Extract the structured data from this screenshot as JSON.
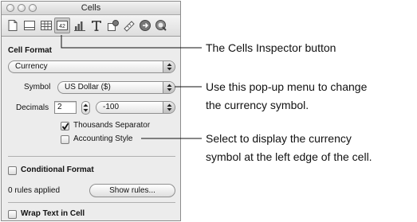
{
  "window": {
    "title": "Cells",
    "toolbar_icons": [
      "document-icon",
      "layout-icon",
      "table-icon",
      "cells-icon",
      "chart-icon",
      "text-icon",
      "graphic-icon",
      "metrics-icon",
      "link-icon",
      "quicktime-icon"
    ],
    "active_tab": "cells-icon",
    "cells_icon_text": "42"
  },
  "cell_format": {
    "heading": "Cell Format",
    "format_value": "Currency",
    "symbol_label": "Symbol",
    "symbol_value": "US Dollar ($)",
    "decimals_label": "Decimals",
    "decimals_value": "2",
    "negative_format_value": "-100",
    "thousands_separator_label": "Thousands Separator",
    "thousands_separator_checked": true,
    "accounting_style_label": "Accounting Style",
    "accounting_style_checked": false
  },
  "conditional_format": {
    "label": "Conditional Format",
    "checked": false,
    "rules_applied_text": "0 rules applied",
    "show_rules_label": "Show rules..."
  },
  "wrap_text": {
    "label": "Wrap Text in Cell",
    "checked": false
  },
  "callouts": {
    "cells_button": "The Cells Inspector button",
    "popup_line1": "Use this pop-up menu to change",
    "popup_line2": "the currency symbol.",
    "accounting_line1": "Select to display the currency",
    "accounting_line2": "symbol at the left edge of the cell."
  }
}
